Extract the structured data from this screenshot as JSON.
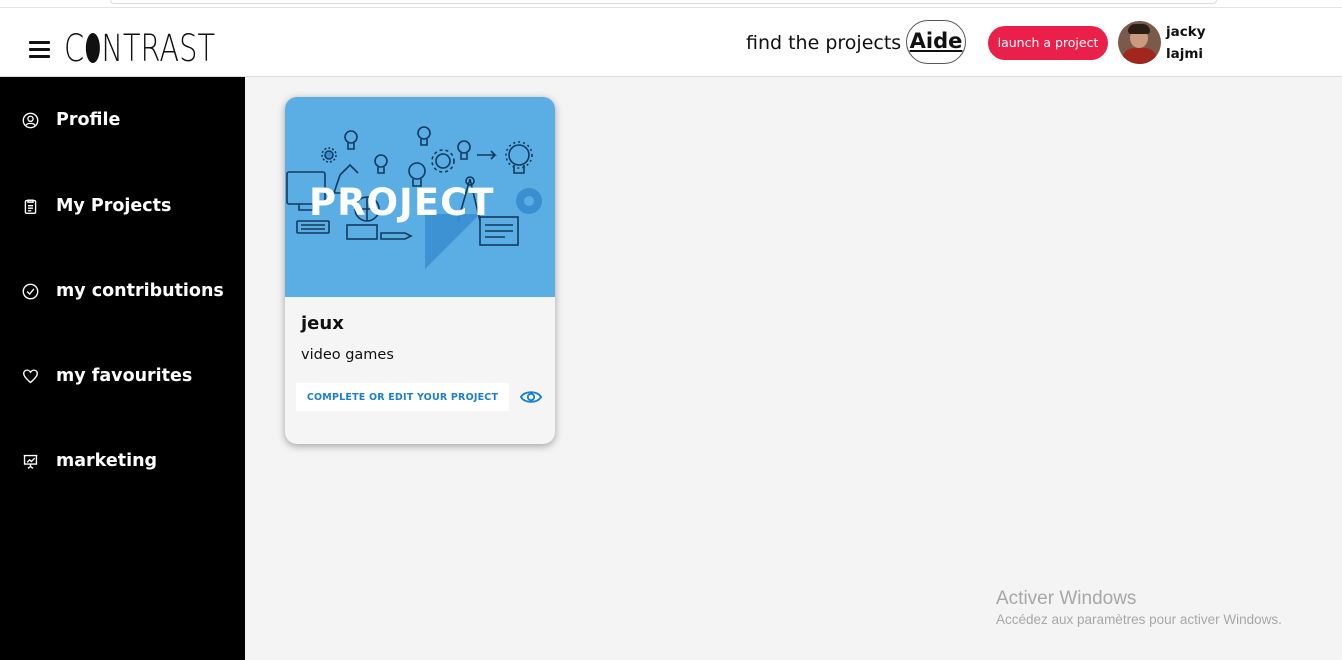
{
  "header": {
    "logo_text": "CONTRAST",
    "find_link": "find the projects",
    "aide_link": "Aide",
    "launch_button": "launch a project",
    "user": {
      "first_name": "jacky",
      "last_name": "lajmi"
    }
  },
  "sidebar": {
    "items": [
      {
        "label": "Profile",
        "icon": "user-circle-icon"
      },
      {
        "label": "My Projects",
        "icon": "clipboard-icon"
      },
      {
        "label": "my contributions",
        "icon": "check-circle-icon"
      },
      {
        "label": "my favourites",
        "icon": "heart-icon"
      },
      {
        "label": "marketing",
        "icon": "presentation-chart-icon"
      }
    ]
  },
  "main": {
    "projects": [
      {
        "image_caption": "PROJECT",
        "title": "jeux",
        "category": "video games",
        "edit_button": "COMPLETE OR EDIT YOUR PROJECT",
        "view_icon": "eye-icon"
      }
    ]
  },
  "watermark": {
    "title": "Activer Windows",
    "subtitle": "Accédez aux paramètres pour activer Windows."
  },
  "colors": {
    "accent": "#ea1f4a",
    "sidebar_bg": "#000000",
    "card_image_bg": "#5aaee4",
    "link_blue": "#1b7fd4"
  }
}
